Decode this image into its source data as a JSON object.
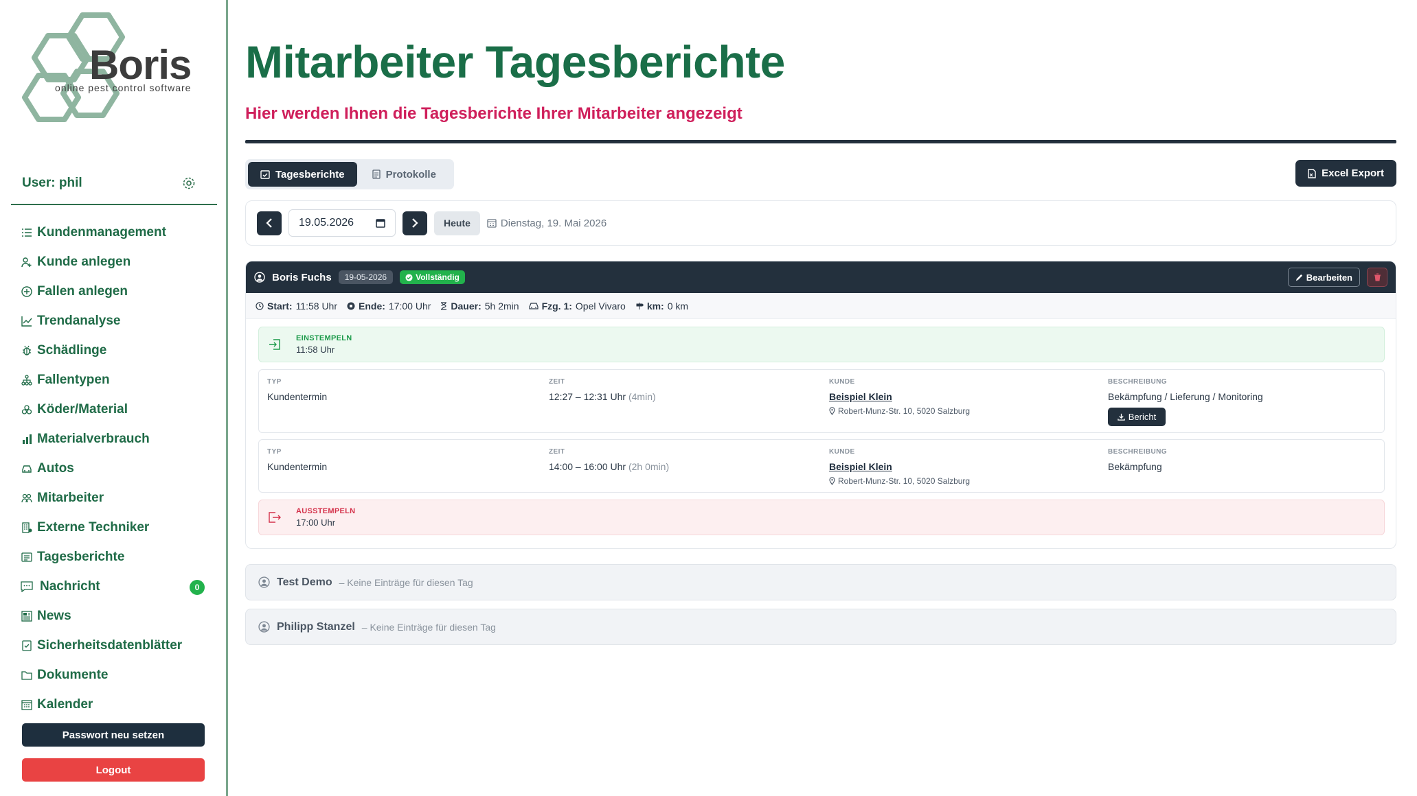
{
  "brand": {
    "name": "Boris",
    "tagline": "online pest control software",
    "color": "#8fb5a0"
  },
  "sidebar": {
    "user_label": "User: phil",
    "items": [
      {
        "label": "Kundenmanagement",
        "icon": "list-icon"
      },
      {
        "label": "Kunde anlegen",
        "icon": "user-add-icon"
      },
      {
        "label": "Fallen anlegen",
        "icon": "plus-circle-icon"
      },
      {
        "label": "Trendanalyse",
        "icon": "chart-line-icon"
      },
      {
        "label": "Schädlinge",
        "icon": "bug-icon"
      },
      {
        "label": "Fallentypen",
        "icon": "diagram-icon"
      },
      {
        "label": "Köder/Material",
        "icon": "boxes-icon"
      },
      {
        "label": "Materialverbrauch",
        "icon": "bar-chart-icon"
      },
      {
        "label": "Autos",
        "icon": "car-icon"
      },
      {
        "label": "Mitarbeiter",
        "icon": "people-icon"
      },
      {
        "label": "Externe Techniker",
        "icon": "building-icon"
      },
      {
        "label": "Tagesberichte",
        "icon": "report-icon"
      },
      {
        "label": "Nachricht",
        "icon": "chat-icon",
        "badge": "0"
      },
      {
        "label": "News",
        "icon": "newspaper-icon"
      },
      {
        "label": "Sicherheitsdatenblätter",
        "icon": "check-doc-icon"
      },
      {
        "label": "Dokumente",
        "icon": "folder-icon"
      },
      {
        "label": "Kalender",
        "icon": "calendar-icon"
      }
    ],
    "password_button": "Passwort neu setzen",
    "logout_button": "Logout"
  },
  "page": {
    "title": "Mitarbeiter Tagesberichte",
    "subtitle": "Hier werden Ihnen die Tagesberichte Ihrer Mitarbeiter angezeigt",
    "title_color": "#1a6e48",
    "subtitle_color": "#cf1f5b"
  },
  "tabs": [
    {
      "label": "Tagesberichte",
      "active": true
    },
    {
      "label": "Protokolle",
      "active": false
    }
  ],
  "excel_button": "Excel Export",
  "datebar": {
    "date_value": "19.05.2026",
    "today_label": "Heute",
    "long_date": "Dienstag, 19. Mai 2026"
  },
  "report": {
    "employee": "Boris Fuchs",
    "date_badge": "19-05-2026",
    "status": "Vollständig",
    "edit_button": "Bearbeiten",
    "meta": {
      "start_label": "Start:",
      "start_value": "11:58 Uhr",
      "end_label": "Ende:",
      "end_value": "17:00 Uhr",
      "duration_label": "Dauer:",
      "duration_value": "5h 2min",
      "vehicle_label": "Fzg. 1:",
      "vehicle_value": "Opel Vivaro",
      "km_label": "km:",
      "km_value": "0 km"
    },
    "clock_in": {
      "label": "EINSTEMPELN",
      "time": "11:58 Uhr"
    },
    "clock_out": {
      "label": "AUSSTEMPELN",
      "time": "17:00 Uhr"
    },
    "columns": {
      "type": "TYP",
      "time": "ZEIT",
      "customer": "KUNDE",
      "description": "BESCHREIBUNG"
    },
    "entries": [
      {
        "type": "Kundentermin",
        "time": "12:27 – 12:31 Uhr",
        "duration": "(4min)",
        "customer": "Beispiel Klein",
        "address": "Robert-Munz-Str. 10, 5020 Salzburg",
        "description": "Bekämpfung / Lieferung / Monitoring",
        "report_button": "Bericht"
      },
      {
        "type": "Kundentermin",
        "time": "14:00 – 16:00 Uhr",
        "duration": "(2h 0min)",
        "customer": "Beispiel Klein",
        "address": "Robert-Munz-Str. 10, 5020 Salzburg",
        "description": "Bekämpfung"
      }
    ]
  },
  "other_employees": [
    {
      "name": "Test Demo",
      "note": "– Keine Einträge für diesen Tag"
    },
    {
      "name": "Philipp Stanzel",
      "note": "– Keine Einträge für diesen Tag"
    }
  ]
}
